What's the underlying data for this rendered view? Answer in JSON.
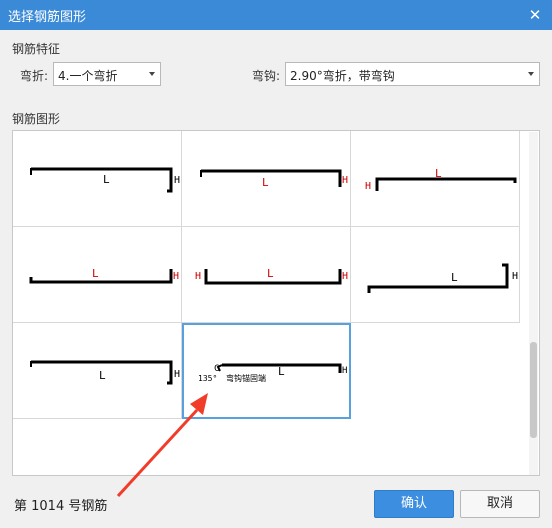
{
  "window": {
    "title": "选择钢筋图形",
    "close_glyph": "✕"
  },
  "features": {
    "section_label": "钢筋特征",
    "bend_label": "弯折:",
    "bend_value": "4.一个弯折",
    "hook_label": "弯钩:",
    "hook_value": "2.90°弯折，带弯钩"
  },
  "gallery": {
    "section_label": "钢筋图形",
    "shapes": [
      {
        "labels": [
          "L",
          "H"
        ],
        "label_color": "#000000"
      },
      {
        "labels": [
          "L",
          "H"
        ],
        "label_color": "#cc0000"
      },
      {
        "labels": [
          "L",
          "H"
        ],
        "label_color": "#cc0000"
      },
      {
        "labels": [
          "L",
          "H"
        ],
        "label_color": "#cc0000"
      },
      {
        "labels": [
          "L",
          "H",
          "H"
        ],
        "label_color": "#cc0000"
      },
      {
        "labels": [
          "L",
          "H"
        ],
        "label_color": "#000000"
      },
      {
        "labels": [
          "L",
          "H"
        ],
        "label_color": "#000000"
      },
      {
        "labels": [
          "L",
          "H",
          "C",
          "135°",
          "弯钩锚固端"
        ],
        "label_color": "#000000",
        "selected": true
      }
    ]
  },
  "footer": {
    "status_text": "第 1014 号钢筋",
    "ok_label": "确认",
    "cancel_label": "取消"
  },
  "colors": {
    "titlebar": "#3b8ad8",
    "selection": "#58a0de",
    "annotation_arrow": "#f23c2a"
  }
}
